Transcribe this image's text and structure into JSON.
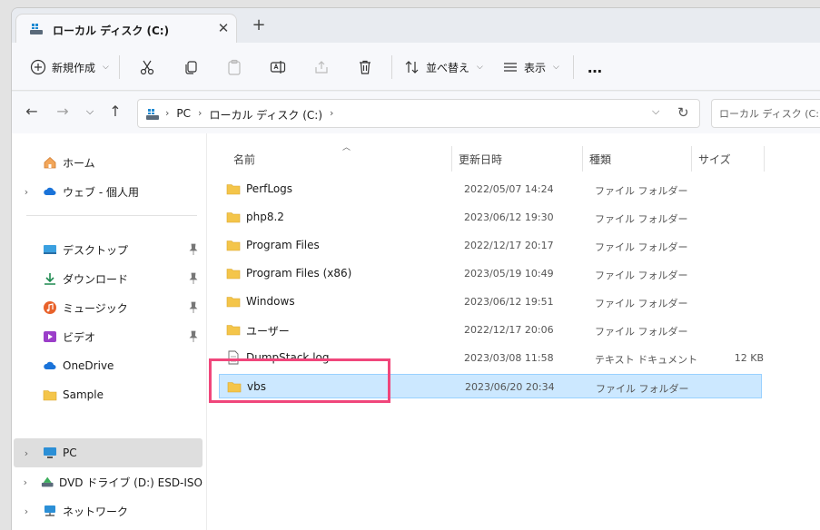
{
  "tab": {
    "title": "ローカル ディスク (C:)",
    "close": "✕",
    "new": "+"
  },
  "toolbar": {
    "new_label": "新規作成",
    "sort_label": "並べ替え",
    "view_label": "表示",
    "more": "…"
  },
  "address": {
    "crumbs": [
      "PC",
      "ローカル ディスク (C:)"
    ],
    "search_placeholder": "ローカル ディスク (C:)の検索"
  },
  "nav": {
    "items": [
      {
        "label": "ホーム"
      },
      {
        "label": "ウェブ - 個人用"
      },
      {
        "label": "デスクトップ"
      },
      {
        "label": "ダウンロード"
      },
      {
        "label": "ミュージック"
      },
      {
        "label": "ビデオ"
      },
      {
        "label": "OneDrive"
      },
      {
        "label": "Sample"
      },
      {
        "label": "PC"
      },
      {
        "label": "DVD ドライブ (D:) ESD-ISO"
      },
      {
        "label": "ネットワーク"
      }
    ]
  },
  "columns": {
    "name": "名前",
    "date": "更新日時",
    "type": "種類",
    "size": "サイズ"
  },
  "files": [
    {
      "name": "PerfLogs",
      "date": "2022/05/07 14:24",
      "type": "ファイル フォルダー",
      "size": ""
    },
    {
      "name": "php8.2",
      "date": "2023/06/12 19:30",
      "type": "ファイル フォルダー",
      "size": ""
    },
    {
      "name": "Program Files",
      "date": "2022/12/17 20:17",
      "type": "ファイル フォルダー",
      "size": ""
    },
    {
      "name": "Program Files (x86)",
      "date": "2023/05/19 10:49",
      "type": "ファイル フォルダー",
      "size": ""
    },
    {
      "name": "Windows",
      "date": "2023/06/12 19:51",
      "type": "ファイル フォルダー",
      "size": ""
    },
    {
      "name": "ユーザー",
      "date": "2022/12/17 20:06",
      "type": "ファイル フォルダー",
      "size": ""
    },
    {
      "name": "DumpStack.log",
      "date": "2023/03/08 11:58",
      "type": "テキスト ドキュメント",
      "size": "12 KB"
    },
    {
      "name": "vbs",
      "date": "2023/06/20 20:34",
      "type": "ファイル フォルダー",
      "size": ""
    }
  ],
  "colors": {
    "selection": "#cce8ff",
    "selection_border": "#99d1ff",
    "annotation": "#f0467b",
    "folder": "#f4c54a"
  }
}
